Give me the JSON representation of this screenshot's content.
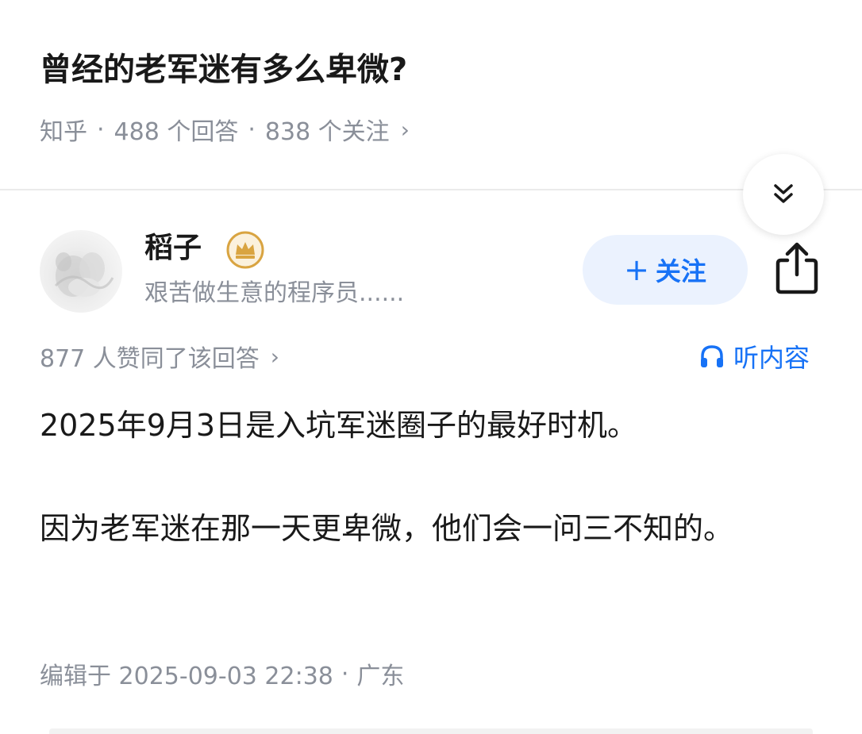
{
  "question": {
    "title": "曾经的老军迷有多么卑微?",
    "source": "知乎",
    "answers": "488 个回答",
    "followers": "838 个关注",
    "separator": "·",
    "chevron": "›"
  },
  "author": {
    "name": "稻子",
    "bio": "艰苦做生意的程序员......",
    "badge_icon": "crown-badge-icon",
    "follow_label": "关注",
    "follow_plus": "+"
  },
  "answer": {
    "upvotes": "877 人赞同了该回答",
    "upvotes_chevron": "›",
    "listen_label": "听内容",
    "paragraphs": [
      "2025年9月3日是入坑军迷圈子的最好时机。",
      "因为老军迷在那一天更卑微，他们会一问三不知的。"
    ],
    "edited": "编辑于 2025-09-03 22:38",
    "separator": "·",
    "location": "广东"
  },
  "colors": {
    "accent": "#1772f6",
    "follow_bg": "#ebf2fe",
    "muted": "#8a8f99",
    "text": "#191919",
    "badge_gold": "#d9a441"
  }
}
